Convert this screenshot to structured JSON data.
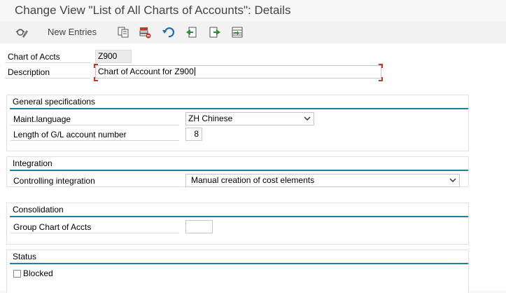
{
  "title": "Change View \"List of All Charts of Accounts\": Details",
  "toolbar": {
    "new_entries_label": "New Entries",
    "icons": [
      "display-change-icon",
      "copy-icon",
      "delete-icon",
      "undo-icon",
      "previous-entry-icon",
      "next-entry-icon",
      "select-all-icon"
    ]
  },
  "header": {
    "chart_label": "Chart of Accts",
    "chart_value": "Z900",
    "description_label": "Description",
    "description_value": "Chart of Account for Z900"
  },
  "general": {
    "title": "General specifications",
    "maint_language_label": "Maint.language",
    "maint_language_value": "ZH Chinese",
    "gl_length_label": "Length of G/L account number",
    "gl_length_value": "8"
  },
  "integration": {
    "title": "Integration",
    "controlling_label": "Controlling integration",
    "controlling_value": "Manual creation of cost elements"
  },
  "consolidation": {
    "title": "Consolidation",
    "group_chart_label": "Group Chart of Accts",
    "group_chart_value": ""
  },
  "status": {
    "title": "Status",
    "blocked_label": "Blocked",
    "blocked_checked": false
  },
  "colors": {
    "accent_line": "#1f7ea1",
    "focus_corner": "#c0392b"
  }
}
